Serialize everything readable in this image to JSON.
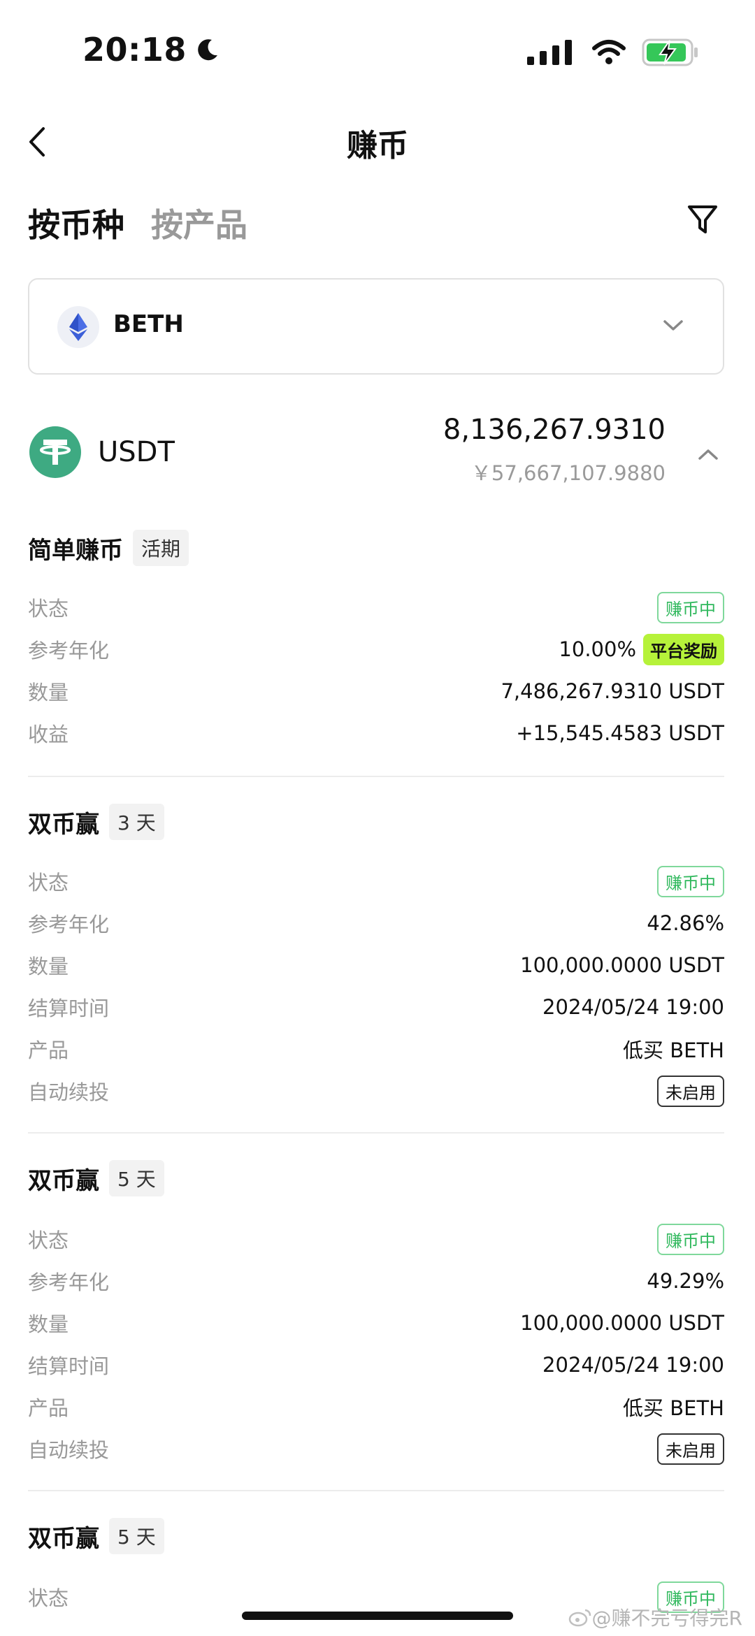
{
  "status_bar": {
    "time": "20:18"
  },
  "header": {
    "title": "赚币"
  },
  "tabs": [
    {
      "label": "按币种"
    },
    {
      "label": "按产品"
    }
  ],
  "selector": {
    "label": "BETH"
  },
  "coin": {
    "name": "USDT",
    "amount": "8,136,267.9310",
    "cny": "￥57,667,107.9880"
  },
  "sections": [
    {
      "title": "简单赚币",
      "tag": "活期",
      "rows": [
        {
          "label": "状态",
          "badge": "赚币中"
        },
        {
          "label": "参考年化",
          "value": "10.00%",
          "reward": "平台奖励"
        },
        {
          "label": "数量",
          "value": "7,486,267.9310 USDT"
        },
        {
          "label": "收益",
          "value": "+15,545.4583 USDT"
        }
      ]
    },
    {
      "title": "双币赢",
      "tag": "3 天",
      "rows": [
        {
          "label": "状态",
          "badge": "赚币中"
        },
        {
          "label": "参考年化",
          "value": "42.86%"
        },
        {
          "label": "数量",
          "value": "100,000.0000 USDT"
        },
        {
          "label": "结算时间",
          "value": "2024/05/24 19:00"
        },
        {
          "label": "产品",
          "value": "低买 BETH"
        },
        {
          "label": "自动续投",
          "badge": "未启用"
        }
      ]
    },
    {
      "title": "双币赢",
      "tag": "5 天",
      "rows": [
        {
          "label": "状态",
          "badge": "赚币中"
        },
        {
          "label": "参考年化",
          "value": "49.29%"
        },
        {
          "label": "数量",
          "value": "100,000.0000 USDT"
        },
        {
          "label": "结算时间",
          "value": "2024/05/24 19:00"
        },
        {
          "label": "产品",
          "value": "低买 BETH"
        },
        {
          "label": "自动续投",
          "badge": "未启用"
        }
      ]
    },
    {
      "title": "双币赢",
      "tag": "5 天",
      "rows": [
        {
          "label": "状态",
          "badge": "赚币中"
        }
      ]
    }
  ],
  "watermark": "@赚不完亏得完R",
  "colors": {
    "accent_green": "#2fb85c",
    "reward_lime": "#b6f23a",
    "usdt_green": "#3eaa82"
  }
}
